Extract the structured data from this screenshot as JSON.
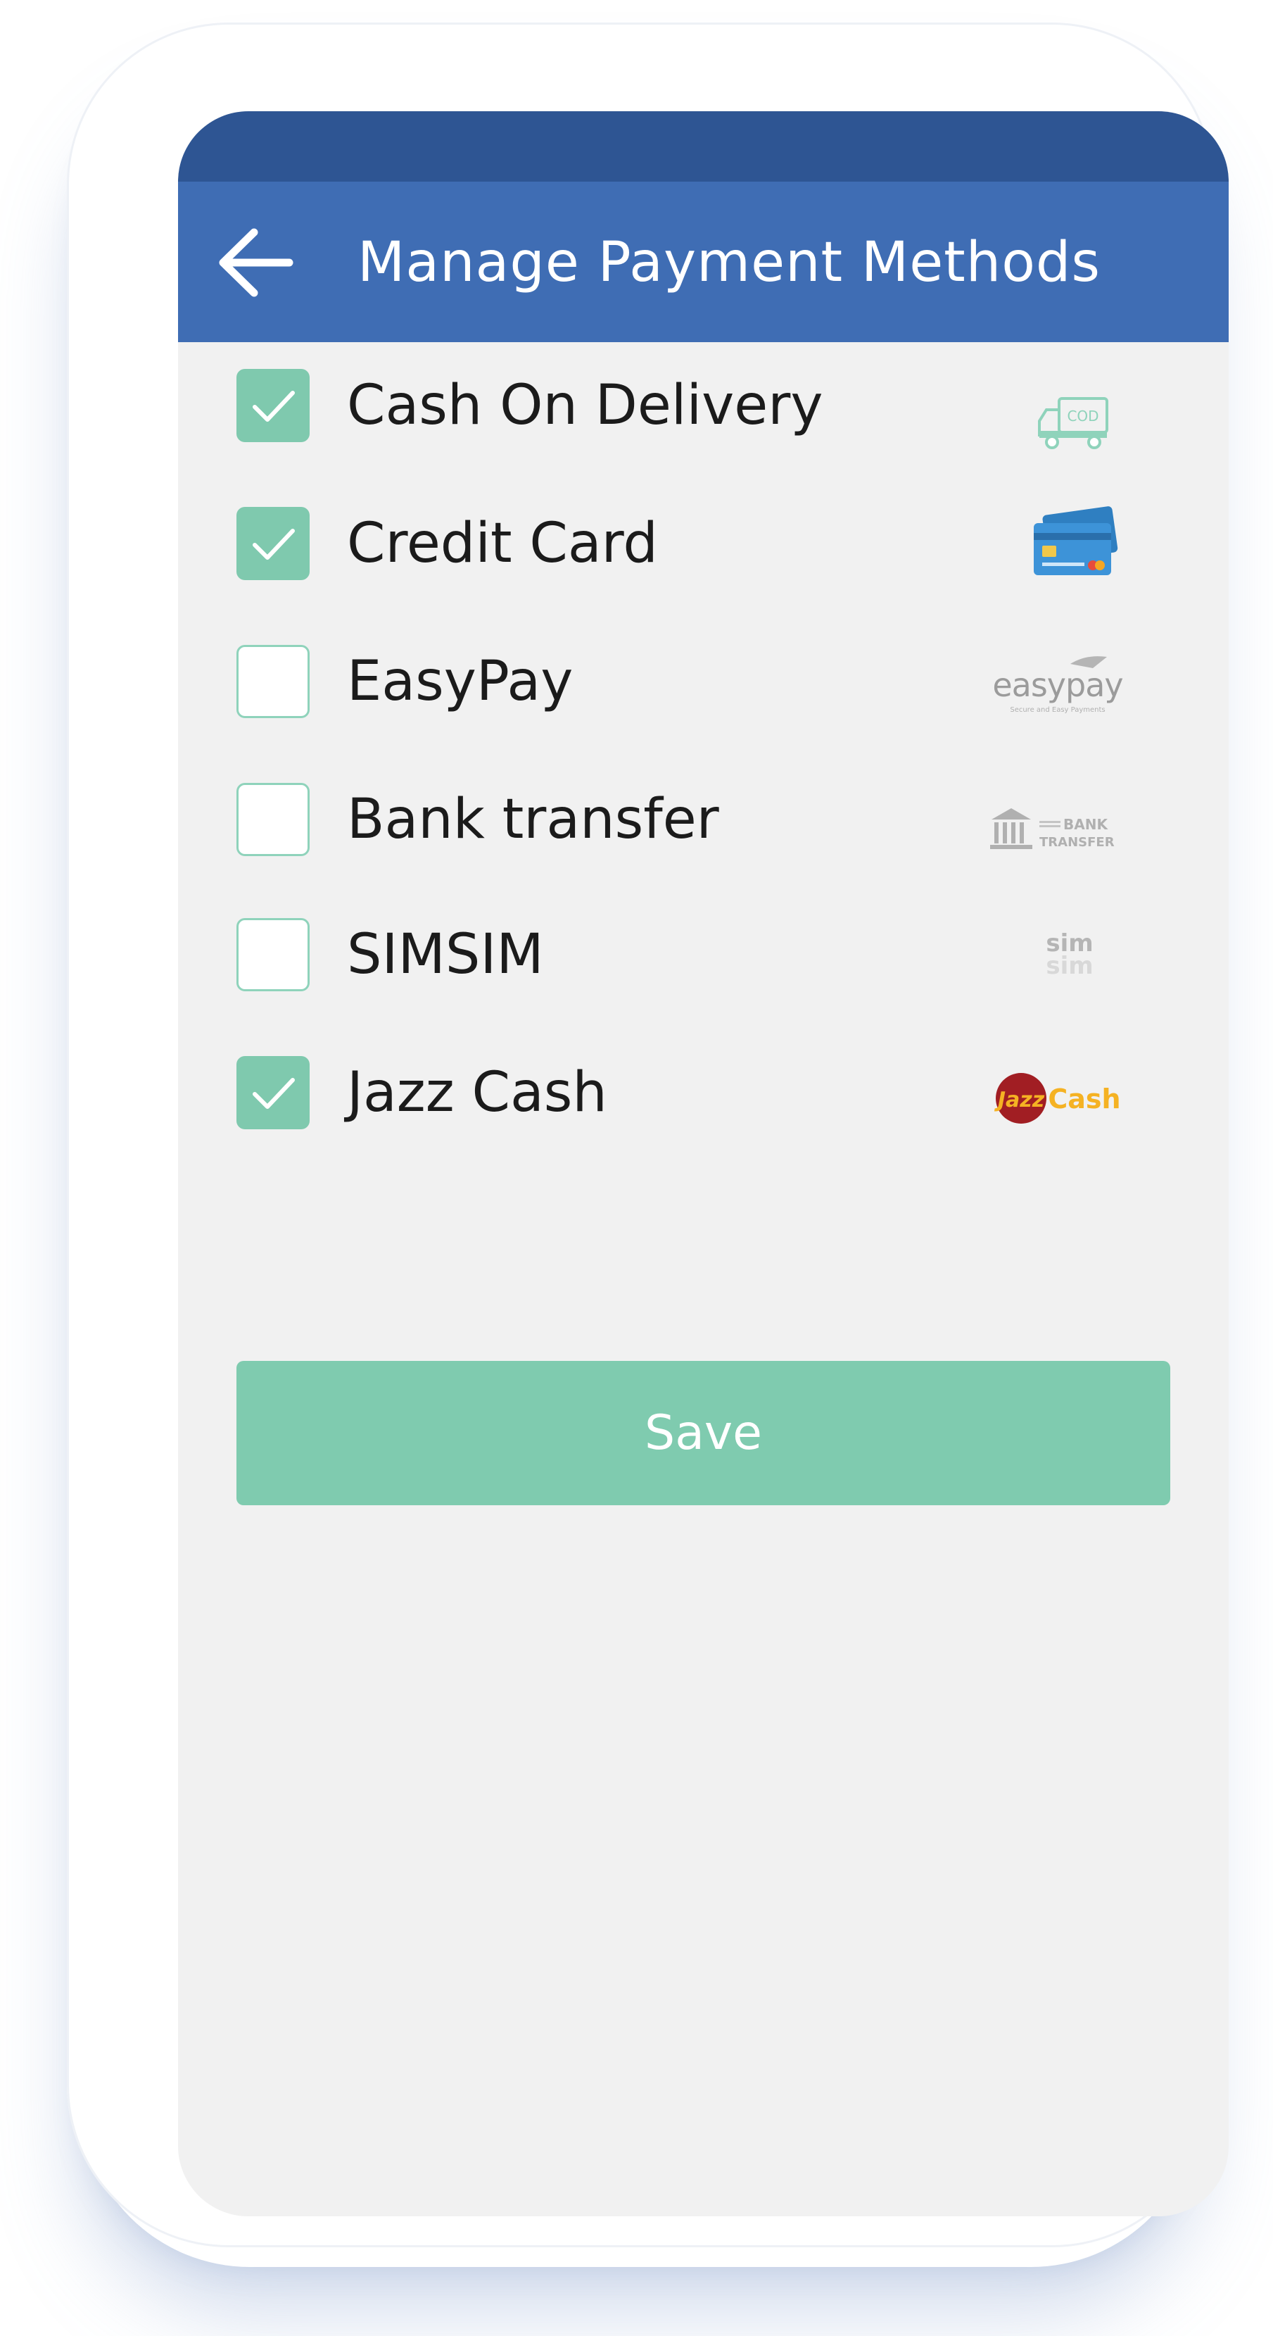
{
  "header": {
    "title": "Manage Payment Methods"
  },
  "payment_methods": [
    {
      "label": "Cash On Delivery",
      "checked": true,
      "icon": "truck-cod-icon"
    },
    {
      "label": "Credit Card",
      "checked": true,
      "icon": "credit-card-icon"
    },
    {
      "label": "EasyPay",
      "checked": false,
      "icon": "easypay-logo"
    },
    {
      "label": "Bank transfer",
      "checked": false,
      "icon": "bank-transfer-logo"
    },
    {
      "label": "SIMSIM",
      "checked": false,
      "icon": "simsim-logo"
    },
    {
      "label": "Jazz Cash",
      "checked": true,
      "icon": "jazzcash-logo"
    }
  ],
  "logos": {
    "cod": "COD",
    "easypay": "easypay",
    "easypay_tagline": "Secure and Easy Payments",
    "bank_line1": "BANK",
    "bank_line2": "TRANSFER",
    "simsim": "sim"
  },
  "save_label": "Save",
  "colors": {
    "status_bar": "#2e5593",
    "app_bar": "#3f6db4",
    "accent": "#7fc9ae",
    "screen_bg": "#f1f1f1"
  }
}
